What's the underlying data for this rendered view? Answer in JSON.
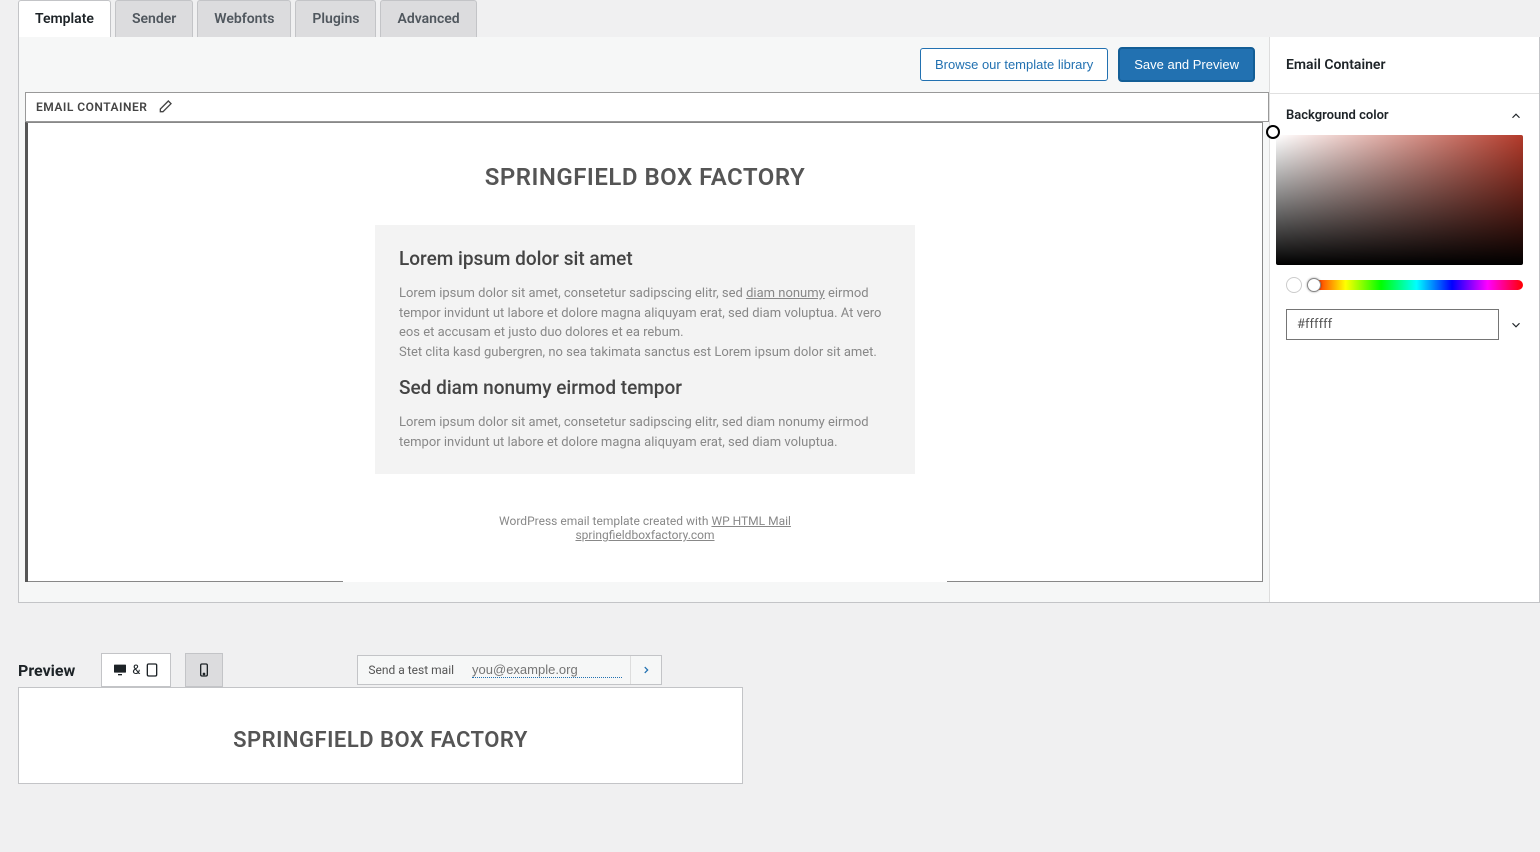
{
  "tabs": {
    "template": "Template",
    "sender": "Sender",
    "webfonts": "Webfonts",
    "plugins": "Plugins",
    "advanced": "Advanced"
  },
  "toolbar": {
    "browse_label": "Browse our template library",
    "save_label": "Save and Preview"
  },
  "block": {
    "label": "EMAIL CONTAINER"
  },
  "email": {
    "header": "SPRINGFIELD BOX FACTORY",
    "h1": "Lorem ipsum dolor sit amet",
    "p1_a": "Lorem ipsum dolor sit amet, consetetur sadipscing elitr, sed ",
    "p1_link": "diam nonumy",
    "p1_b": " eirmod tempor invidunt ut labore et dolore magna aliquyam erat, sed diam voluptua. At vero eos et accusam et justo duo dolores et ea rebum.",
    "p1_c": "Stet clita kasd gubergren, no sea takimata sanctus est Lorem ipsum dolor sit amet.",
    "h2": "Sed diam nonumy eirmod tempor",
    "p2": "Lorem ipsum dolor sit amet, consetetur sadipscing elitr, sed diam nonumy eirmod tempor invidunt ut labore et dolore magna aliquyam erat, sed diam voluptua.",
    "footer_a": "WordPress email template created with ",
    "footer_link": "WP HTML Mail",
    "footer_b": "springfieldboxfactory.com"
  },
  "sidebar": {
    "title": "Email Container",
    "panel_bg": "Background color",
    "hex": "#ffffff"
  },
  "preview": {
    "title": "Preview",
    "amp": "&",
    "test_label": "Send a test mail",
    "test_placeholder": "you@example.org",
    "header": "SPRINGFIELD BOX FACTORY"
  }
}
